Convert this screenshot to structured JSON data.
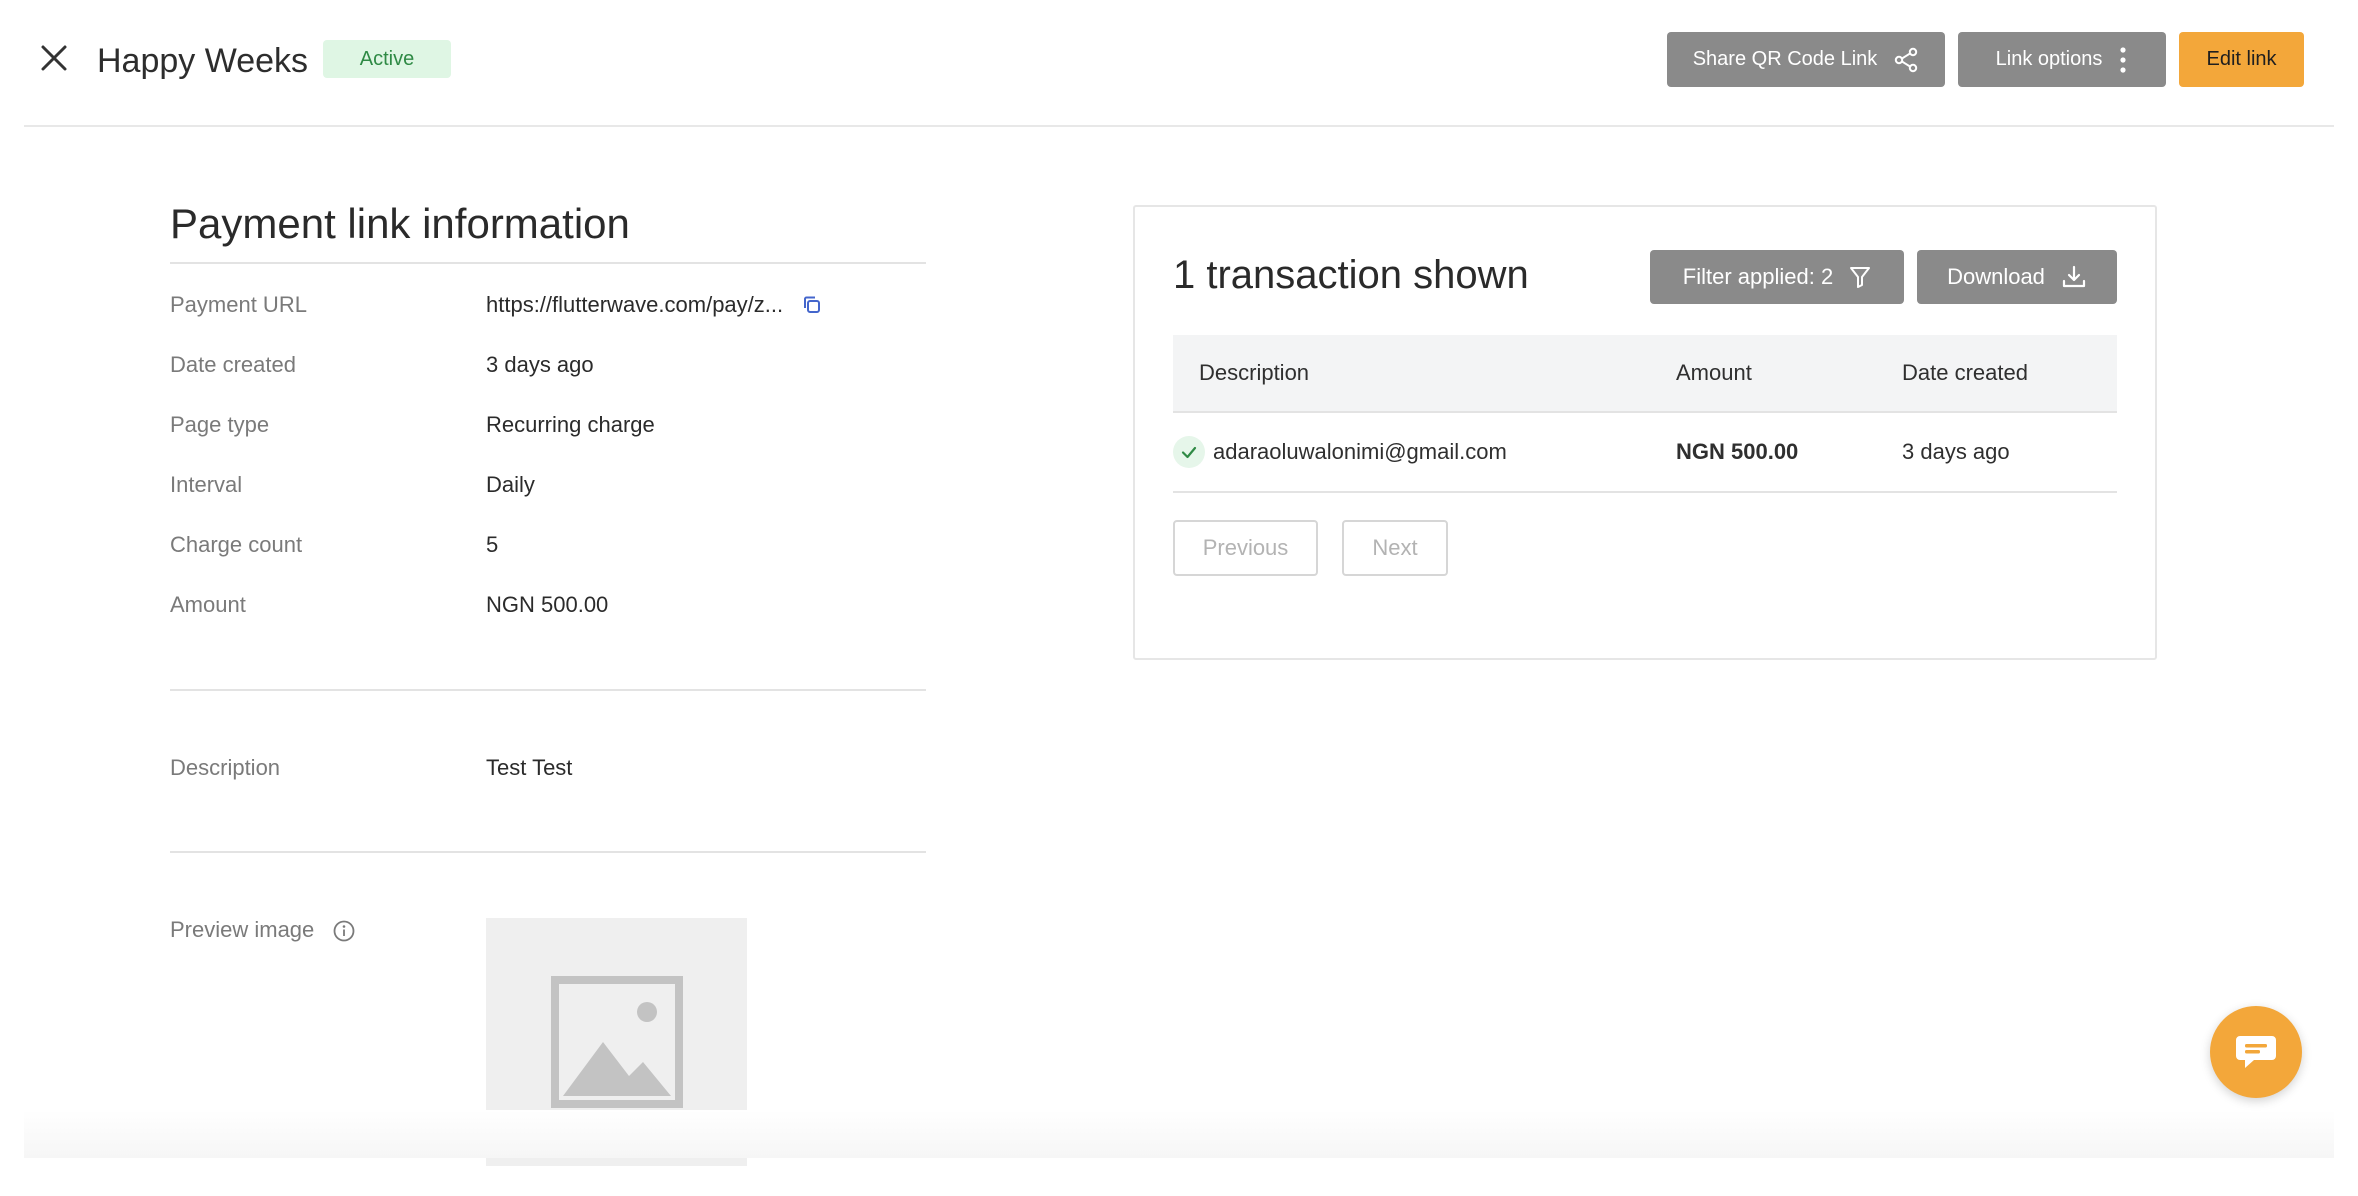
{
  "header": {
    "title": "Happy Weeks",
    "status": "Active",
    "share_label": "Share QR Code Link",
    "options_label": "Link options",
    "edit_label": "Edit link"
  },
  "info": {
    "section_title": "Payment link information",
    "rows": [
      {
        "label": "Payment URL",
        "value": "https://flutterwave.com/pay/z..."
      },
      {
        "label": "Date created",
        "value": "3 days ago"
      },
      {
        "label": "Page type",
        "value": "Recurring charge"
      },
      {
        "label": "Interval",
        "value": "Daily"
      },
      {
        "label": "Charge count",
        "value": "5"
      },
      {
        "label": "Amount",
        "value": "NGN 500.00"
      }
    ],
    "description_label": "Description",
    "description_value": "Test Test",
    "preview_label": "Preview image"
  },
  "transactions": {
    "title": "1 transaction shown",
    "filter_label": "Filter applied: 2",
    "download_label": "Download",
    "columns": [
      "Description",
      "Amount",
      "Date created"
    ],
    "rows": [
      {
        "description": "adaraoluwalonimi@gmail.com",
        "amount": "NGN 500.00",
        "date": "3 days ago"
      }
    ],
    "previous_label": "Previous",
    "next_label": "Next"
  },
  "colors": {
    "accent": "#f3a73a",
    "button_gray": "#8a8a8a",
    "link": "#4466cc",
    "active_badge_bg": "#dff6e4",
    "active_badge_text": "#2f8a45"
  },
  "icons": {
    "close": "close-icon",
    "share": "share-icon",
    "options": "vertical-dots-icon",
    "copy": "copy-icon",
    "info": "info-icon",
    "image_placeholder": "image-placeholder-icon",
    "filter": "filter-icon",
    "download": "download-icon",
    "check": "check-icon",
    "chat": "chat-icon"
  }
}
